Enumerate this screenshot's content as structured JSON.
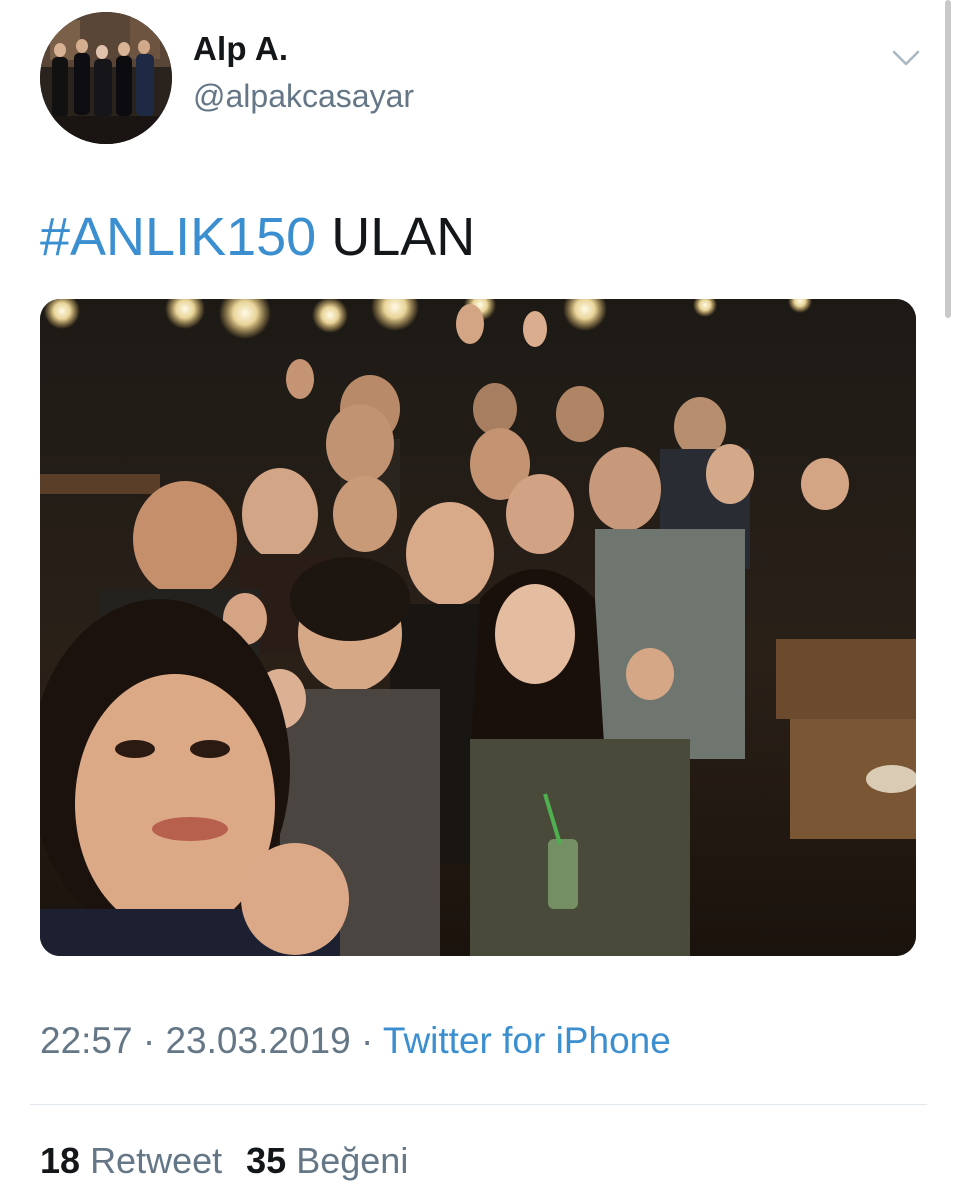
{
  "tweet": {
    "author": {
      "display_name": "Alp A.",
      "handle": "@alpakcasayar"
    },
    "text": {
      "hashtag": "#ANLIK150",
      "rest": " ULAN"
    },
    "meta": {
      "time": "22:57",
      "separator1": " · ",
      "date": "23.03.2019",
      "separator2": " · ",
      "source": "Twitter for iPhone"
    },
    "stats": {
      "retweet_count": "18",
      "retweet_label": "Retweet",
      "like_count": "35",
      "like_label": "Beğeni"
    }
  },
  "icons": {
    "menu": "chevron-down-icon"
  },
  "colors": {
    "link": "#3b8fd0",
    "secondary_text": "#657786",
    "primary_text": "#14171a",
    "divider": "#e1e8ed"
  }
}
